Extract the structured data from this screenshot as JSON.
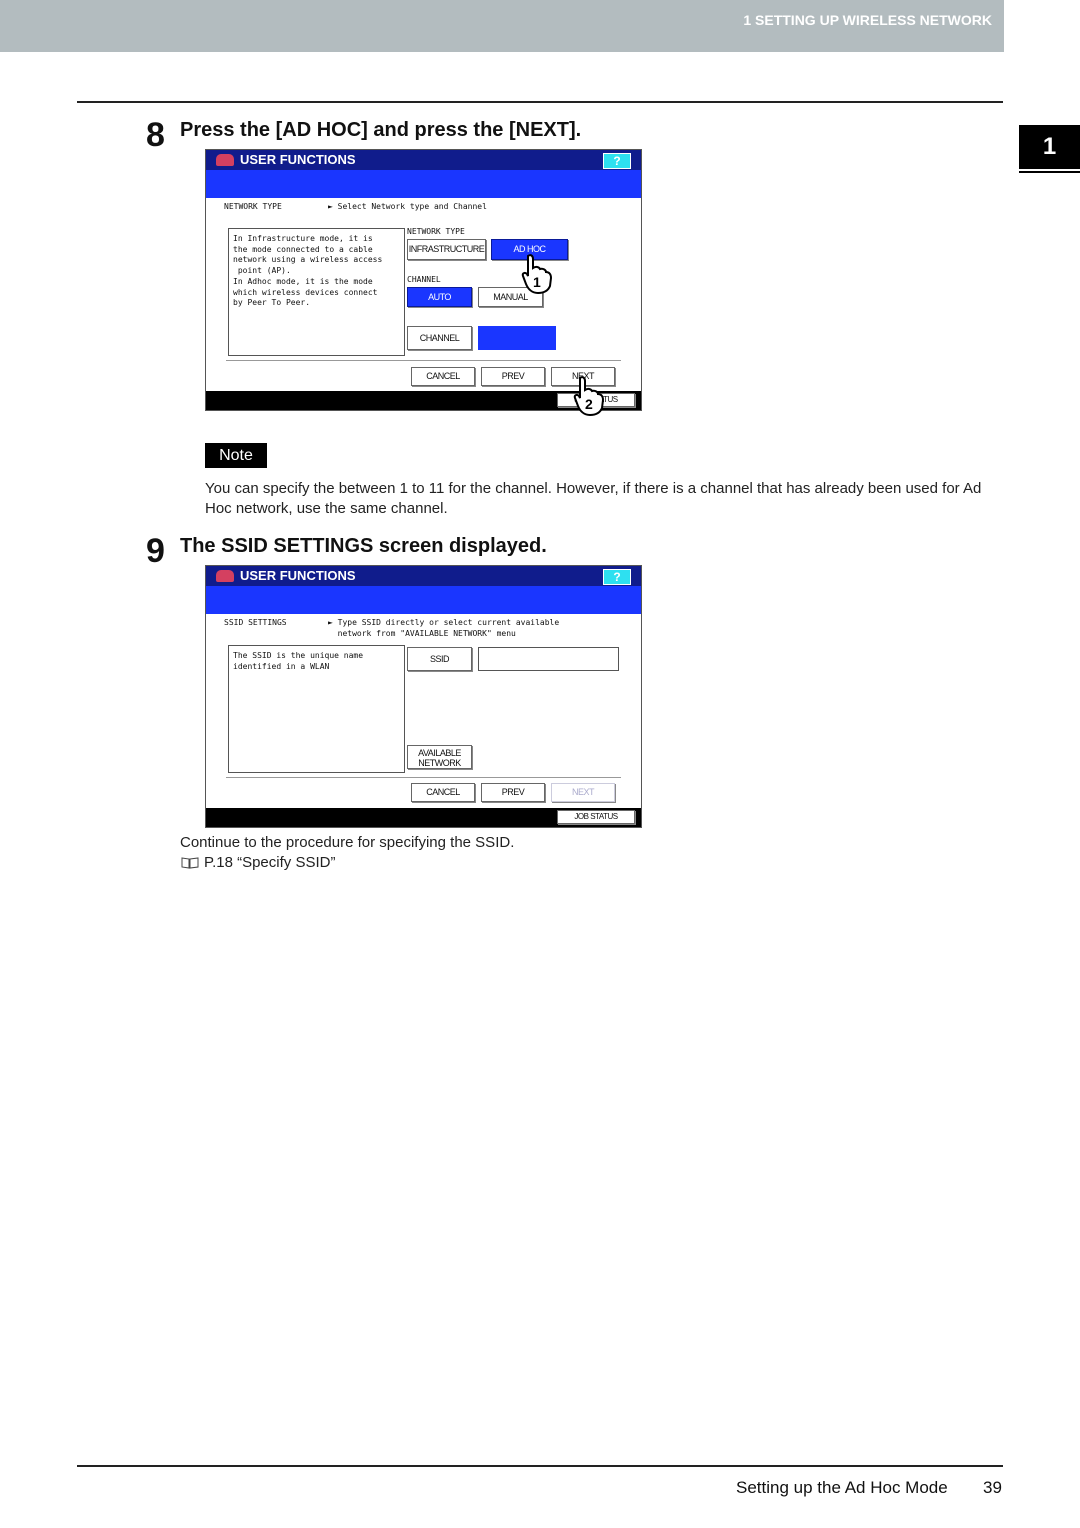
{
  "header": {
    "chapter_title": "1 SETTING UP WIRELESS NETWORK",
    "chapter_tab": "1"
  },
  "step8": {
    "number": "8",
    "title": "Press the [AD HOC] and press the [NEXT].",
    "screen": {
      "title": "USER FUNCTIONS",
      "help": "?",
      "section": "NETWORK TYPE",
      "instruction": "► Select Network type and Channel",
      "description": "In Infrastructure mode, it is\nthe mode connected to a cable\nnetwork using a wireless access\n point (AP).\nIn Adhoc mode, it is the mode\nwhich wireless devices connect\nby Peer To Peer.",
      "network_type_label": "NETWORK TYPE",
      "infrastructure": "INFRASTRUCTURE",
      "adhoc": "AD HOC",
      "channel_label": "CHANNEL",
      "auto": "AUTO",
      "manual": "MANUAL",
      "channel_button": "CHANNEL",
      "channel_value": "",
      "cancel": "CANCEL",
      "prev": "PREV",
      "next": "NEXT",
      "job_status": "JOB STATUS",
      "callout1": "1",
      "callout2": "2"
    }
  },
  "note": {
    "label": "Note",
    "text": "You can specify the between 1 to 11 for the channel. However, if there is a channel that has already been used for Ad Hoc network, use the same channel."
  },
  "step9": {
    "number": "9",
    "title": "The SSID SETTINGS screen displayed.",
    "screen": {
      "title": "USER FUNCTIONS",
      "help": "?",
      "section": "SSID SETTINGS",
      "instruction": "► Type SSID directly or select current available\n  network from \"AVAILABLE NETWORK\" menu",
      "description": "The SSID is the unique name\nidentified in a WLAN",
      "ssid_button": "SSID",
      "ssid_value": "",
      "available_network": "AVAILABLE\nNETWORK",
      "cancel": "CANCEL",
      "prev": "PREV",
      "next": "NEXT",
      "job_status": "JOB STATUS"
    },
    "continue_text": "Continue to the procedure for specifying the SSID.",
    "reference": "P.18 “Specify SSID”"
  },
  "footer": {
    "title": "Setting up the Ad Hoc Mode",
    "page": "39"
  }
}
